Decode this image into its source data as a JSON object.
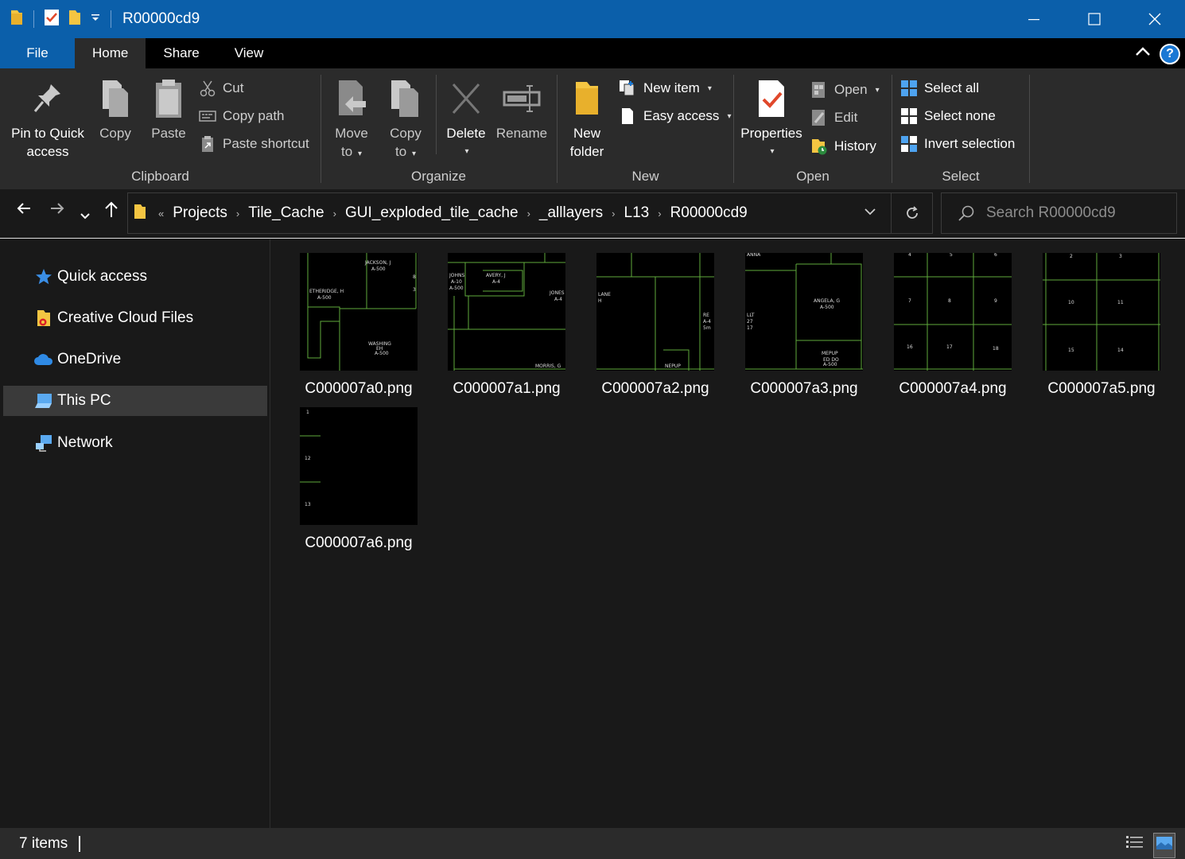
{
  "window": {
    "title": "R00000cd9"
  },
  "ribbon_tabs": {
    "file": "File",
    "home": "Home",
    "share": "Share",
    "view": "View",
    "help": "?"
  },
  "clipboard": {
    "title": "Clipboard",
    "pin_line1": "Pin to Quick",
    "pin_line2": "access",
    "copy": "Copy",
    "paste": "Paste",
    "cut": "Cut",
    "copy_path": "Copy path",
    "paste_shortcut": "Paste shortcut"
  },
  "organize": {
    "title": "Organize",
    "move_line1": "Move",
    "move_line2": "to",
    "copyto_line1": "Copy",
    "copyto_line2": "to",
    "delete": "Delete",
    "rename": "Rename"
  },
  "new": {
    "title": "New",
    "folder_line1": "New",
    "folder_line2": "folder",
    "new_item": "New item",
    "easy_access": "Easy access"
  },
  "open": {
    "title": "Open",
    "properties": "Properties",
    "open": "Open",
    "edit": "Edit",
    "history": "History"
  },
  "select": {
    "title": "Select",
    "select_all": "Select all",
    "select_none": "Select none",
    "invert": "Invert selection"
  },
  "address": {
    "overflow": "«",
    "crumbs": [
      "Projects",
      "Tile_Cache",
      "GUI_exploded_tile_cache",
      "_alllayers",
      "L13",
      "R00000cd9"
    ],
    "search_placeholder": "Search R00000cd9"
  },
  "nav": {
    "items": [
      "Quick access",
      "Creative Cloud Files",
      "OneDrive",
      "This PC",
      "Network"
    ]
  },
  "files": [
    "C000007a0.png",
    "C000007a1.png",
    "C000007a2.png",
    "C000007a3.png",
    "C000007a4.png",
    "C000007a5.png",
    "C000007a6.png"
  ],
  "status": {
    "items": "7 items"
  },
  "colors": {
    "titlebar": "#0b5faa",
    "ribbon": "#2b2b2b",
    "background": "#191919",
    "map_lines": "#5faa3c"
  }
}
